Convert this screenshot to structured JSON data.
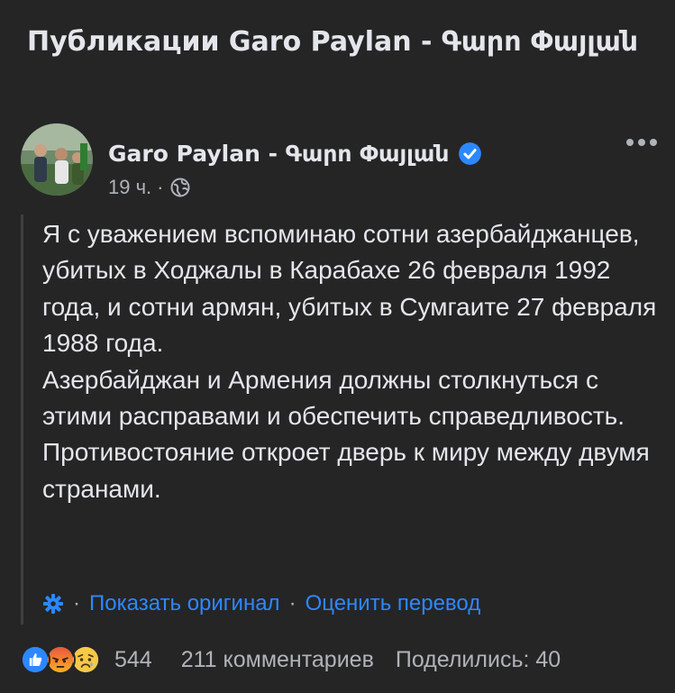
{
  "header": {
    "title": "Публикации Garo Paylan - Գարո Փայլան"
  },
  "post": {
    "author": "Garo Paylan - Գարո Փայլան",
    "time": "19 ч.",
    "meta_separator": "·",
    "paragraphs": [
      "Я с уважением вспоминаю сотни азербайджанцев, убитых в Ходжалы в Карабахе 26 февраля 1992 года, и сотни армян, убитых в Сумгаите 27 февраля 1988 года.",
      "Азербайджан и Армения должны столкнуться с этими расправами и обеспечить справедливость.",
      "Противостояние откроет дверь к миру между двумя странами."
    ],
    "translation": {
      "separator": "·",
      "show_original": "Показать оригинал",
      "rate_translation": "Оценить перевод"
    }
  },
  "footer": {
    "reaction_count": "544",
    "comments": "211 комментариев",
    "shares": "Поделились: 40"
  },
  "colors": {
    "background": "#252526",
    "text_primary": "#e4e6eb",
    "text_secondary": "#b0b3b8",
    "link": "#2d88ff",
    "verified": "#2d88ff"
  },
  "icons": [
    "verified-badge-icon",
    "globe-icon",
    "more-options-icon",
    "gear-icon",
    "like-reaction-icon",
    "angry-reaction-icon",
    "sad-reaction-icon"
  ]
}
